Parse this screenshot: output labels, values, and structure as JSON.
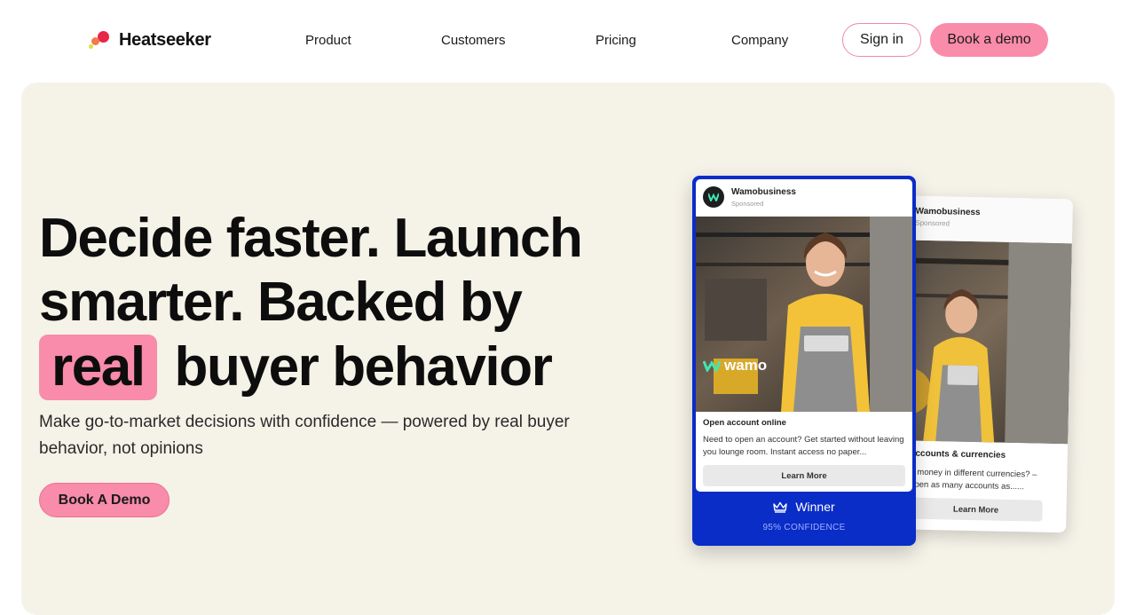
{
  "brand": {
    "name": "Heatseeker"
  },
  "nav": {
    "links": [
      "Product",
      "Customers",
      "Pricing",
      "Company"
    ],
    "sign_in": "Sign in",
    "book_demo": "Book a demo"
  },
  "hero": {
    "headline_line1": "Decide faster. Launch",
    "headline_line2": "smarter. Backed by",
    "headline_highlight": "real",
    "headline_line3_rest": "buyer behavior",
    "subhead": "Make go-to-market decisions with confidence — powered by real buyer behavior, not opinions",
    "cta": "Book A Demo"
  },
  "ad_front": {
    "advertiser": "Wamobusiness",
    "sponsored": "Sponsored",
    "logo_overlay": "wamo",
    "headline": "Open account online",
    "body": "Need to open an account? Get started without leaving you lounge room. Instant access no paper...",
    "cta": "Learn More",
    "result": "Winner",
    "confidence": "95% CONFIDENCE"
  },
  "ad_back": {
    "advertiser": "Wamobusiness",
    "sponsored": "Sponsored",
    "headline": "accounts & currencies",
    "body": "d money in different currencies? – open as many accounts as......",
    "cta": "Learn More"
  },
  "colors": {
    "accent_pink": "#f98bab",
    "hero_bg": "#f5f2e8",
    "winner_blue": "#0a2cc7"
  }
}
